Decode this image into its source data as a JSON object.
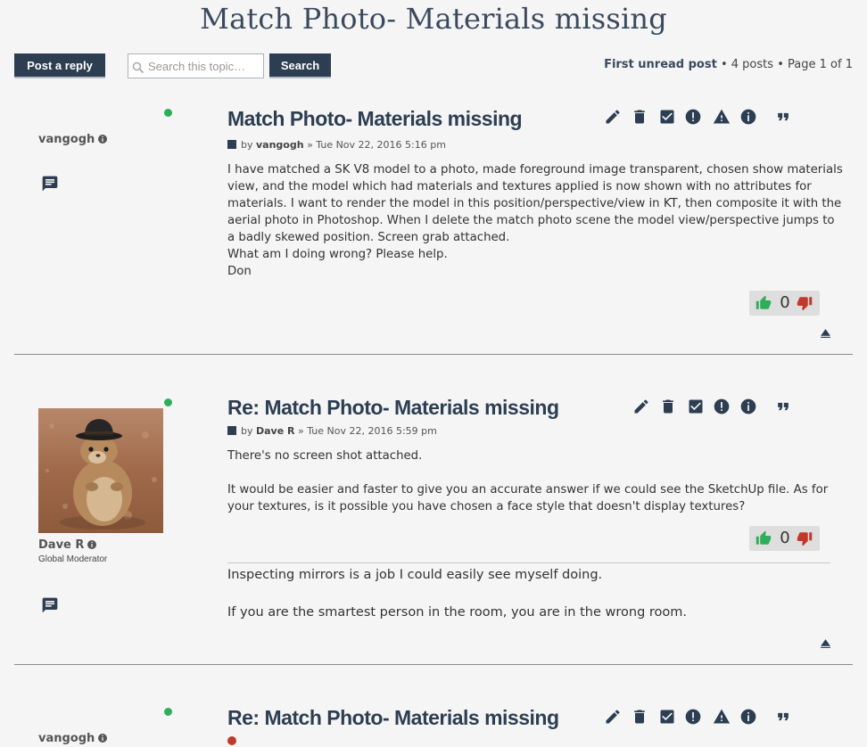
{
  "page": {
    "title": "Match Photo- Materials missing"
  },
  "toolbar": {
    "post_reply_label": "Post a reply",
    "search_placeholder": "Search this topic…",
    "search_value": "",
    "search_label": "Search",
    "first_unread": "First unread post",
    "post_count": "4 posts",
    "page_label": "Page",
    "page_current": "1",
    "page_of": "of",
    "page_total": "1",
    "sep": "•"
  },
  "posts": [
    {
      "author": "vangogh",
      "online": true,
      "title": "Match Photo- Materials missing",
      "by_label": "by",
      "arrow": "»",
      "date": "Tue Nov 22, 2016 5:16 pm",
      "body": [
        "I have matched a SK V8 model to a photo, made foreground image transparent, chosen show materials view, and the model which had materials and textures applied is now shown with no attributes for materials. I want to render the model in this position/perspective/view in KT, then composite it with the aerial photo in Photoshop. When I delete the match photo scene the model view/perspective jumps to a badly skewed position. Screen grab attached.",
        "What am I doing wrong? Please help.",
        "Don"
      ],
      "votes": "0"
    },
    {
      "author": "Dave R",
      "rank": "Global Moderator",
      "online": true,
      "title": "Re: Match Photo- Materials missing",
      "by_label": "by",
      "arrow": "»",
      "date": "Tue Nov 22, 2016 5:59 pm",
      "body": [
        "There's no screen shot attached.",
        "It would be easier and faster to give you an accurate answer if we could see the SketchUp file. As for your textures, is it possible you have chosen a face style that doesn't display textures?"
      ],
      "votes": "0",
      "signature": [
        "Inspecting mirrors is a job I could easily see myself doing.",
        "If you are the smartest person in the room, you are in the wrong room."
      ]
    },
    {
      "author": "vangogh",
      "online": true,
      "title": "Re: Match Photo- Materials missing"
    }
  ],
  "colors": {
    "primary": "#2d3e52",
    "online": "#2fae5a",
    "thumb_up": "#2fae5a",
    "thumb_down": "#c0392b",
    "background": "#f5f5f5"
  },
  "icons": {
    "tools": [
      "pencil-icon",
      "trash-icon",
      "checkbox-icon",
      "alert-circle-icon",
      "warning-icon",
      "info-icon",
      "quote-icon"
    ],
    "vote": [
      "thumbs-up-icon",
      "thumbs-down-icon"
    ],
    "misc": [
      "search-icon",
      "message-icon",
      "arrow-up-icon"
    ]
  }
}
